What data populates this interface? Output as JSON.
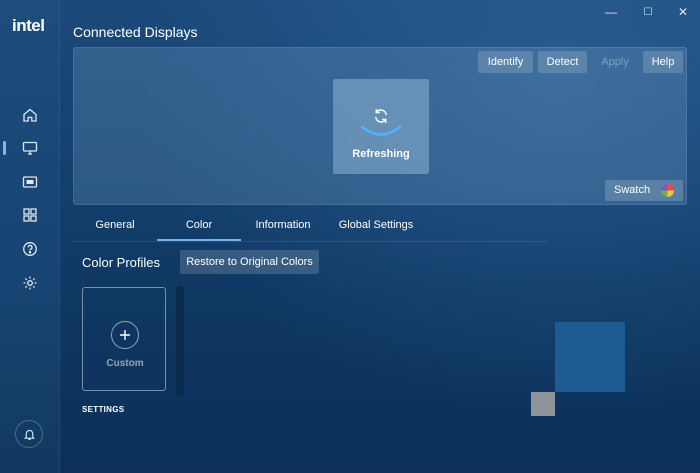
{
  "window": {
    "controls": [
      "—",
      "☐",
      "✕"
    ]
  },
  "sidebar": {
    "logo": "intel",
    "items": [
      {
        "icon": "home-icon"
      },
      {
        "icon": "monitor-icon",
        "active": true
      },
      {
        "icon": "video-icon"
      },
      {
        "icon": "apps-grid-icon"
      },
      {
        "icon": "help-icon"
      },
      {
        "icon": "gear-icon"
      }
    ],
    "bell_icon": "bell-icon"
  },
  "header": {
    "title": "Connected Displays"
  },
  "toolbar": {
    "identify_label": "Identify",
    "detect_label": "Detect",
    "apply_label": "Apply",
    "help_label": "Help"
  },
  "display_panel": {
    "status_label": "Refreshing",
    "swatch_label": "Swatch"
  },
  "tabs": [
    {
      "label": "General"
    },
    {
      "label": "Color",
      "active": true
    },
    {
      "label": "Information"
    },
    {
      "label": "Global Settings"
    }
  ],
  "color_profiles": {
    "title": "Color Profiles",
    "restore_label": "Restore to Original Colors",
    "custom_label": "Custom",
    "settings_label": "SETTINGS"
  },
  "colors": {
    "accent": "#6fb4f0",
    "background": "#0d2f57"
  }
}
